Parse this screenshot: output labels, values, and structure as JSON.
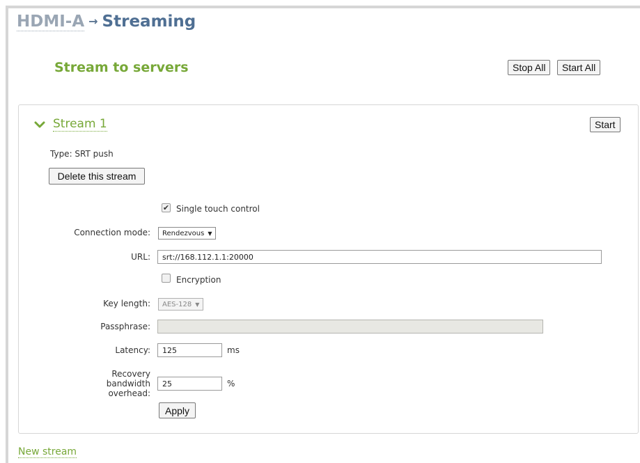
{
  "breadcrumb": {
    "device": "HDMI-A",
    "separator": "→",
    "page": "Streaming"
  },
  "section": {
    "title": "Stream to servers",
    "stop_all_label": "Stop All",
    "start_all_label": "Start All"
  },
  "stream": {
    "name": "Stream 1",
    "expanded": true,
    "start_label": "Start",
    "type_text": "Type: SRT push",
    "delete_label": "Delete this stream",
    "single_touch": {
      "label": "Single touch control",
      "checked": true,
      "mark": "✔"
    },
    "connection_mode": {
      "label": "Connection mode:",
      "value": "Rendezvous",
      "caret": "▼"
    },
    "url": {
      "label": "URL:",
      "value": "srt://168.112.1.1:20000"
    },
    "encryption": {
      "label": "Encryption",
      "checked": false
    },
    "key_length": {
      "label": "Key length:",
      "value": "AES-128",
      "caret": "▼",
      "disabled": true
    },
    "passphrase": {
      "label": "Passphrase:",
      "value": "",
      "disabled": true
    },
    "latency": {
      "label": "Latency:",
      "value": "125",
      "unit": "ms"
    },
    "recovery": {
      "label_line1": "Recovery bandwidth",
      "label_line2": "overhead:",
      "value": "25",
      "unit": "%"
    },
    "apply_label": "Apply"
  },
  "new_stream_label": "New stream",
  "colors": {
    "accent_green": "#77a838",
    "title_blue": "#4f6f93",
    "device_gray": "#9aa6b4"
  }
}
